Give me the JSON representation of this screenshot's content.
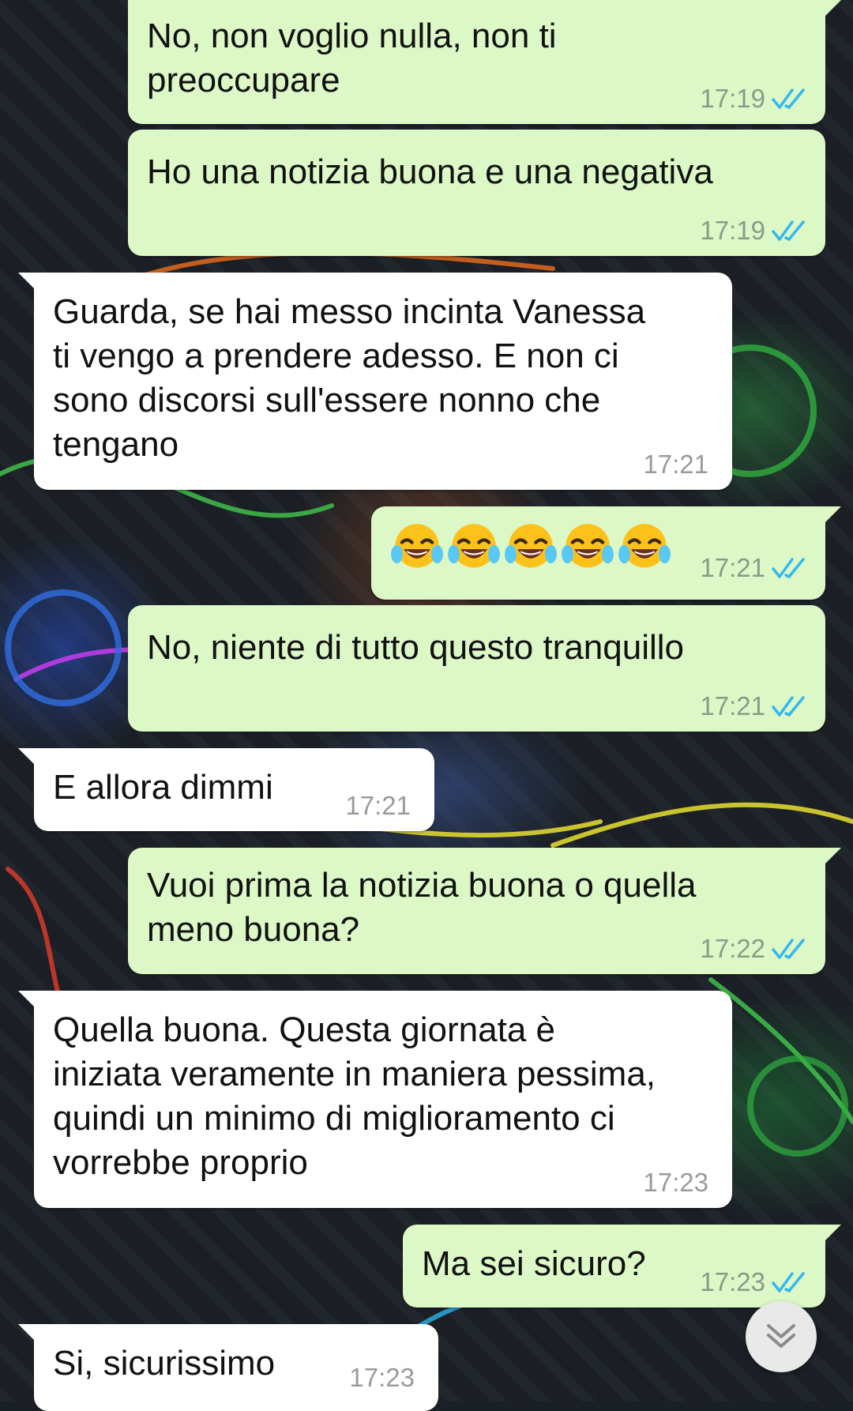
{
  "colors": {
    "outgoing_bubble": "#dcf8c6",
    "incoming_bubble": "#ffffff",
    "read_ticks": "#34b7f1"
  },
  "messages": [
    {
      "direction": "out",
      "text": "No, non voglio nulla, non ti\npreoccupare",
      "time": "17:19",
      "status": "read"
    },
    {
      "direction": "out",
      "text": "Ho una notizia buona e una negativa",
      "time": "17:19",
      "status": "read"
    },
    {
      "direction": "in",
      "text": "Guarda, se hai messo incinta Vanessa\nti vengo a prendere adesso. E non ci\nsono discorsi sull'essere nonno che\ntengano",
      "time": "17:21"
    },
    {
      "direction": "out",
      "emoji": "face-with-tears-of-joy",
      "emoji_count": 5,
      "time": "17:21",
      "status": "read"
    },
    {
      "direction": "out",
      "text": "No, niente di tutto questo tranquillo",
      "time": "17:21",
      "status": "read"
    },
    {
      "direction": "in",
      "text": "E allora dimmi",
      "time": "17:21"
    },
    {
      "direction": "out",
      "text": "Vuoi prima la notizia buona o quella\nmeno buona?",
      "time": "17:22",
      "status": "read"
    },
    {
      "direction": "in",
      "text": "Quella buona. Questa giornata è\niniziata veramente in maniera pessima,\nquindi un minimo di miglioramento ci\nvorrebbe proprio",
      "time": "17:23"
    },
    {
      "direction": "out",
      "text": "Ma sei sicuro?",
      "time": "17:23",
      "status": "read"
    },
    {
      "direction": "in",
      "text": "Si, sicurissimo",
      "time": "17:23"
    }
  ],
  "scroll_button_icon": "double-chevron-down-icon"
}
